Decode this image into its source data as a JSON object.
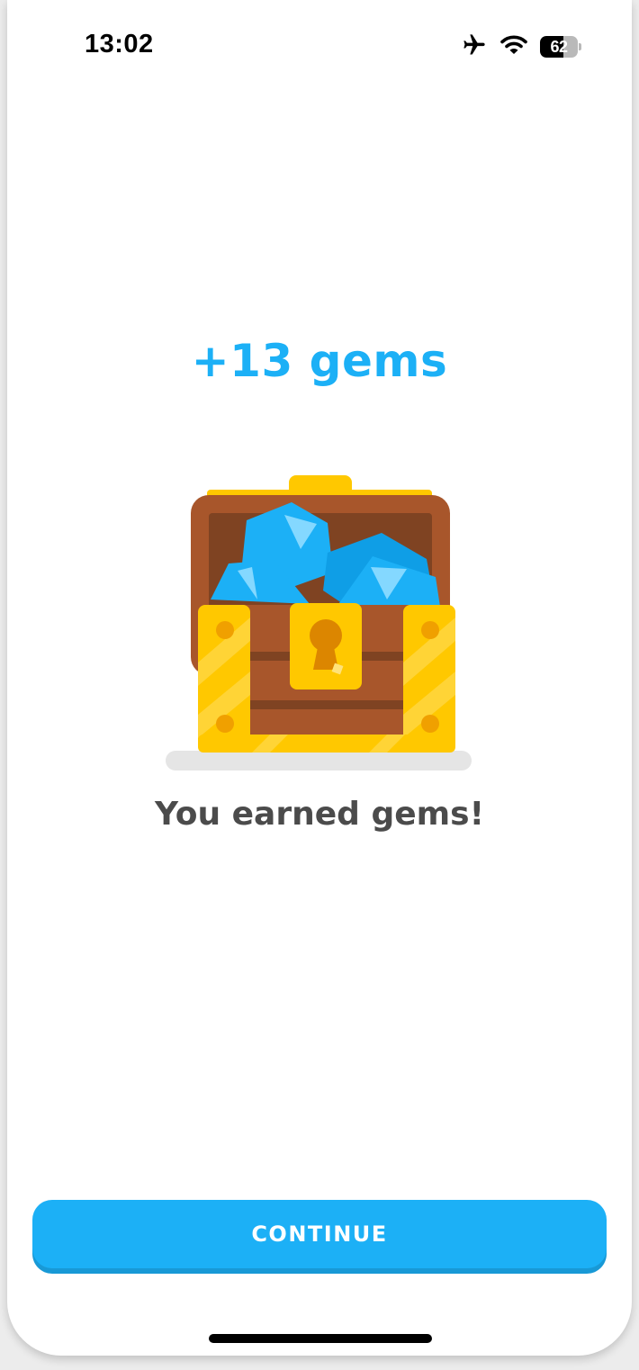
{
  "status_bar": {
    "time": "13:02",
    "battery_level": "62",
    "battery_fraction": 0.62,
    "icons": [
      "airplane-icon",
      "wifi-icon",
      "battery-icon"
    ]
  },
  "reward": {
    "title": "+13 gems",
    "subtitle": "You earned gems!",
    "illustration": "treasure-chest-with-gems"
  },
  "actions": {
    "continue_label": "CONTINUE"
  },
  "colors": {
    "accent": "#1cb0f6",
    "accent_shadow": "#1899d6",
    "text": "#4b4b4b",
    "chest_gold": "#ffc800",
    "chest_wood": "#a8562b",
    "gem_blue": "#1cb0f6"
  }
}
